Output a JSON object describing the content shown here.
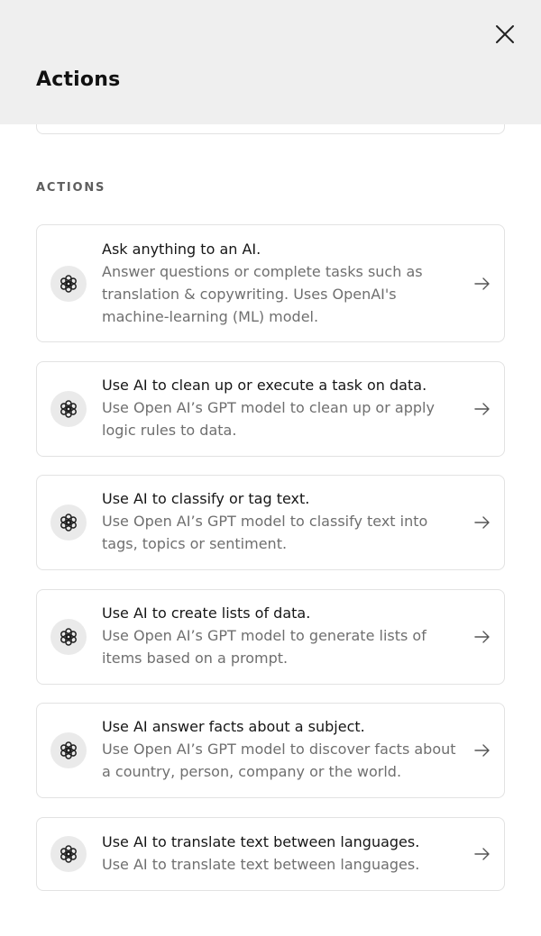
{
  "header": {
    "title": "Actions",
    "close_icon": "close-icon"
  },
  "section": {
    "label": "ACTIONS"
  },
  "actions": [
    {
      "title": "Ask anything to an AI.",
      "description": "Answer questions or complete tasks such as translation & copywriting. Uses OpenAI's machine-learning (ML) model.",
      "icon": "openai-icon"
    },
    {
      "title": "Use AI to clean up or execute a task on data.",
      "description": "Use Open AI’s GPT model to clean up or apply logic rules to data.",
      "icon": "openai-icon"
    },
    {
      "title": "Use AI to classify or tag text.",
      "description": "Use Open AI’s GPT model to classify text into tags, topics or sentiment.",
      "icon": "openai-icon"
    },
    {
      "title": "Use AI to create lists of data.",
      "description": "Use Open AI’s GPT model to generate lists of items based on a prompt.",
      "icon": "openai-icon"
    },
    {
      "title": "Use AI answer facts about a subject.",
      "description": "Use Open AI’s GPT model to discover facts about a country, person, company or the world.",
      "icon": "openai-icon"
    },
    {
      "title": "Use AI to translate text between languages.",
      "description": "Use AI to translate text between languages.",
      "icon": "openai-icon"
    }
  ],
  "colors": {
    "header_bg": "#efefef",
    "card_border": "#e2e2e2",
    "icon_bg": "#eaeaea",
    "desc_text": "#6f6f6f"
  }
}
